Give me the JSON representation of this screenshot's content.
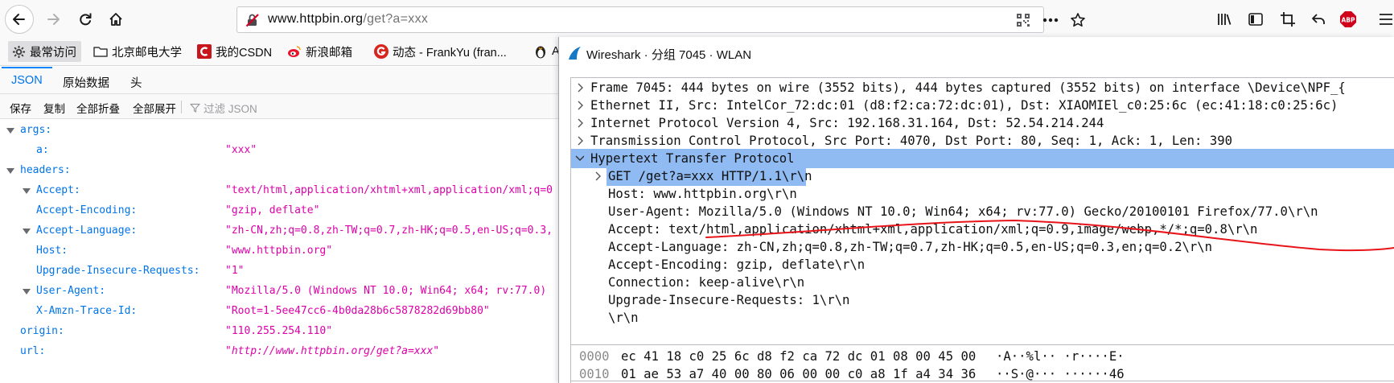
{
  "browser": {
    "url_main": "www.httpbin.org",
    "url_rest": "/get?a=xxx"
  },
  "bookmarks": [
    {
      "label": "最常访问",
      "icon": "gear-icon"
    },
    {
      "label": "北京邮电大学",
      "icon": "folder-icon"
    },
    {
      "label": "我的CSDN",
      "icon": "csdn-icon"
    },
    {
      "label": "新浪邮箱",
      "icon": "weibo-icon"
    },
    {
      "label": "动态 - FrankYu (fran...",
      "icon": "g-icon"
    },
    {
      "label": "A",
      "icon": "penguin-icon"
    }
  ],
  "json_viewer": {
    "tabs": [
      "JSON",
      "原始数据",
      "头"
    ],
    "tools": [
      "保存",
      "复制",
      "全部折叠",
      "全部展开"
    ],
    "filter_placeholder": "过滤 JSON",
    "rows": [
      {
        "key": "args:",
        "value": ""
      },
      {
        "key": "a:",
        "value": "\"xxx\""
      },
      {
        "key": "headers:",
        "value": ""
      },
      {
        "key": "Accept:",
        "value": "\"text/html,application/xhtml+xml,application/xml;q=0"
      },
      {
        "key": "Accept-Encoding:",
        "value": "\"gzip, deflate\""
      },
      {
        "key": "Accept-Language:",
        "value": "\"zh-CN,zh;q=0.8,zh-TW;q=0.7,zh-HK;q=0.5,en-US;q=0.3,"
      },
      {
        "key": "Host:",
        "value": "\"www.httpbin.org\""
      },
      {
        "key": "Upgrade-Insecure-Requests:",
        "value": "\"1\""
      },
      {
        "key": "User-Agent:",
        "value": "\"Mozilla/5.0 (Windows NT 10.0; Win64; x64; rv:77.0)"
      },
      {
        "key": "X-Amzn-Trace-Id:",
        "value": "\"Root=1-5ee47cc6-4b0da28b6c5878282d69bb80\""
      },
      {
        "key": "origin:",
        "value": "\"110.255.254.110\""
      },
      {
        "key": "url:",
        "value": "\"http://www.httpbin.org/get?a=xxx\""
      }
    ]
  },
  "wireshark": {
    "title": "Wireshark · 分组 7045 · WLAN",
    "tree": [
      "Frame 7045: 444 bytes on wire (3552 bits), 444 bytes captured (3552 bits) on interface \\Device\\NPF_{",
      "Ethernet II, Src: IntelCor_72:dc:01 (d8:f2:ca:72:dc:01), Dst: XIAOMIEl_c0:25:6c (ec:41:18:c0:25:6c)",
      "Internet Protocol Version 4, Src: 192.168.31.164, Dst: 52.54.214.244",
      "Transmission Control Protocol, Src Port: 4070, Dst Port: 80, Seq: 1, Ack: 1, Len: 390",
      "Hypertext Transfer Protocol",
      "GET /get?a=xxx HTTP/1.1\\r\\n",
      "Host: www.httpbin.org\\r\\n",
      "User-Agent: Mozilla/5.0 (Windows NT 10.0; Win64; x64; rv:77.0) Gecko/20100101 Firefox/77.0\\r\\n",
      "Accept: text/html,application/xhtml+xml,application/xml;q=0.9,image/webp,*/*;q=0.8\\r\\n",
      "Accept-Language: zh-CN,zh;q=0.8,zh-TW;q=0.7,zh-HK;q=0.5,en-US;q=0.3,en;q=0.2\\r\\n",
      "Accept-Encoding: gzip, deflate\\r\\n",
      "Connection: keep-alive\\r\\n",
      "Upgrade-Insecure-Requests: 1\\r\\n",
      "\\r\\n"
    ],
    "hex": [
      {
        "offset": "0000",
        "bytes": "ec 41 18 c0 25 6c d8 f2  ca 72 dc 01 08 00 45 00",
        "ascii": "·A··%l·· ·r····E·"
      },
      {
        "offset": "0010",
        "bytes": "01 ae 53 a7 40 00 80 06  00 00 c0 a8 1f a4 34 36",
        "ascii": "··S·@··· ······46"
      }
    ]
  }
}
